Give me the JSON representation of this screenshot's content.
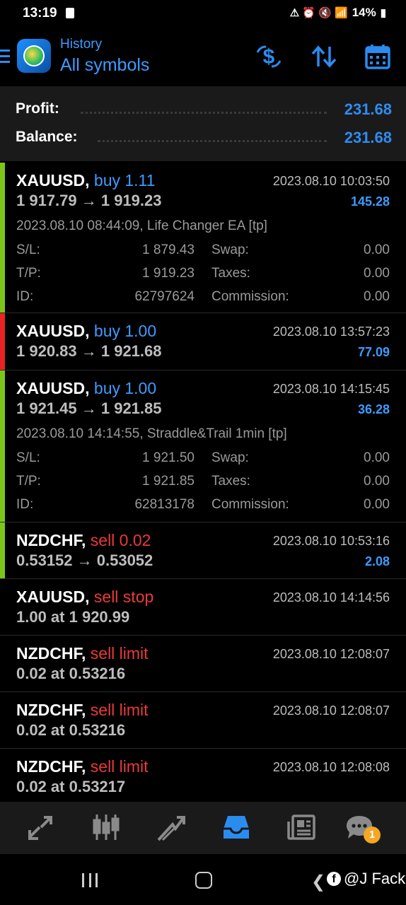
{
  "status_bar": {
    "time": "13:19",
    "battery": "14%"
  },
  "header": {
    "subtitle": "History",
    "title": "All symbols"
  },
  "summary": {
    "profit_label": "Profit:",
    "profit_value": "231.68",
    "balance_label": "Balance:",
    "balance_value": "231.68"
  },
  "colors": {
    "accent": "#3d9bff",
    "buy_bar": "#7cc618",
    "loss_bar": "#e82424",
    "sell": "#ea3a3a"
  },
  "positions": [
    {
      "symbol": "XAUUSD,",
      "type": "buy 1.11",
      "price": "1 917.79 → 1 919.23",
      "date": "2023.08.10 10:03:50",
      "profit": "145.28",
      "comment": "2023.08.10 08:44:09, Life Changer EA [tp]",
      "sl_label": "S/L:",
      "sl": "1 879.43",
      "swap_label": "Swap:",
      "swap": "0.00",
      "tp_label": "T/P:",
      "tp": "1 919.23",
      "taxes_label": "Taxes:",
      "taxes": "0.00",
      "id_label": "ID:",
      "id": "62797624",
      "commission_label": "Commission:",
      "commission": "0.00"
    },
    {
      "symbol": "XAUUSD,",
      "type": "buy 1.00",
      "price": "1 920.83 → 1 921.68",
      "date": "2023.08.10 13:57:23",
      "profit": "77.09"
    },
    {
      "symbol": "XAUUSD,",
      "type": "buy 1.00",
      "price": "1 921.45 → 1 921.85",
      "date": "2023.08.10 14:15:45",
      "profit": "36.28",
      "comment": "2023.08.10 14:14:55, Straddle&Trail 1min [tp]",
      "sl_label": "S/L:",
      "sl": "1 921.50",
      "swap_label": "Swap:",
      "swap": "0.00",
      "tp_label": "T/P:",
      "tp": "1 921.85",
      "taxes_label": "Taxes:",
      "taxes": "0.00",
      "id_label": "ID:",
      "id": "62813178",
      "commission_label": "Commission:",
      "commission": "0.00"
    },
    {
      "symbol": "NZDCHF,",
      "type": "sell 0.02",
      "price": "0.53152 → 0.53052",
      "date": "2023.08.10 10:53:16",
      "profit": "2.08"
    }
  ],
  "orders": [
    {
      "symbol": "XAUUSD,",
      "type": "sell stop",
      "price": "1.00 at 1 920.99",
      "date": "2023.08.10 14:14:56"
    },
    {
      "symbol": "NZDCHF,",
      "type": "sell limit",
      "price": "0.02 at 0.53216",
      "date": "2023.08.10 12:08:07"
    },
    {
      "symbol": "NZDCHF,",
      "type": "sell limit",
      "price": "0.02 at 0.53216",
      "date": "2023.08.10 12:08:07"
    },
    {
      "symbol": "NZDCHF,",
      "type": "sell limit",
      "price": "0.02 at 0.53217",
      "date": "2023.08.10 12:08:08"
    }
  ],
  "bottom_nav": {
    "items": [
      "quotes-icon",
      "chart-icon",
      "trade-icon",
      "history-icon",
      "news-icon",
      "chat-icon"
    ],
    "chat_badge": "1"
  },
  "watermark": "@J Fack"
}
